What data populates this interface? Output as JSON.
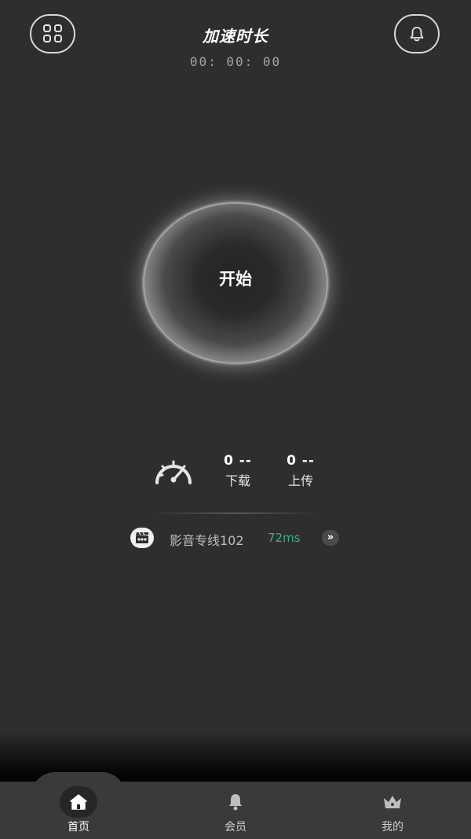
{
  "header": {
    "title": "加速时长",
    "timer": "00: 00: 00",
    "menu_icon": "grid-icon",
    "notify_icon": "bell-icon"
  },
  "start": {
    "label": "开始"
  },
  "stats": {
    "download": {
      "value": "0 --",
      "label": "下载"
    },
    "upload": {
      "value": "0 --",
      "label": "上传"
    }
  },
  "line": {
    "name": "影音专线102",
    "ping": "72ms",
    "switch": "»",
    "ping_color": "#3bb37a"
  },
  "tabbar": {
    "items": [
      {
        "label": "首页",
        "icon": "home-icon",
        "active": true
      },
      {
        "label": "会员",
        "icon": "bell-icon",
        "active": false
      },
      {
        "label": "我的",
        "icon": "crown-icon",
        "active": false
      }
    ]
  }
}
